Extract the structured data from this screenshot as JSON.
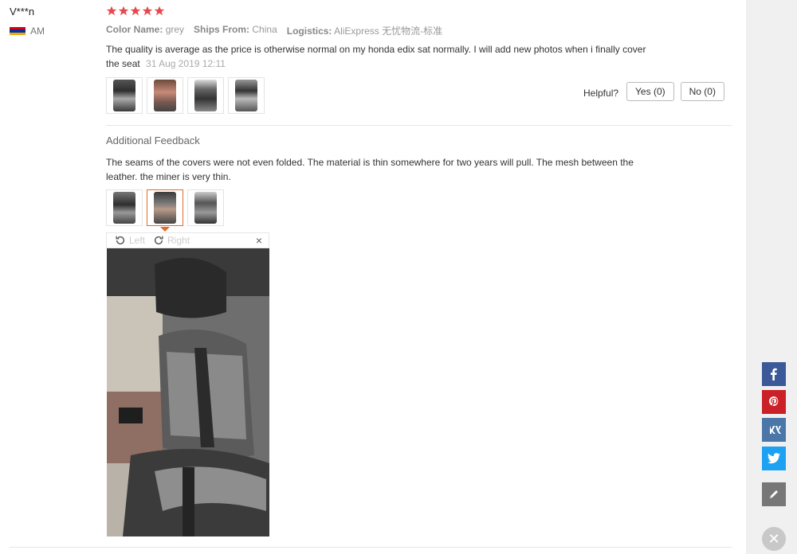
{
  "reviewer": {
    "name": "V***n",
    "country_code": "AM",
    "flag_colors": [
      "#d90012",
      "#0033a0",
      "#f2a800"
    ]
  },
  "rating": {
    "stars": 5,
    "star_color": "#e5484d"
  },
  "meta": {
    "color_label": "Color Name:",
    "color_value": "grey",
    "ships_label": "Ships From:",
    "ships_value": "China",
    "logistics_label": "Logistics:",
    "logistics_value": "AliExpress 无忧物流-标准"
  },
  "review": {
    "text": "The quality is average as the price is otherwise normal on my honda edix sat normally. I will add new photos when i finally cover the seat",
    "date": "31 Aug 2019 12:11",
    "photos": [
      "seat-photo-1",
      "seat-photo-2",
      "seat-photo-3",
      "seat-photo-4"
    ]
  },
  "helpful": {
    "label": "Helpful?",
    "yes_label": "Yes (0)",
    "no_label": "No (0)"
  },
  "additional": {
    "title": "Additional Feedback",
    "text": "The seams of the covers were not even folded. The material is thin somewhere for two years will pull. The mesh between the leather. the miner is very thin.",
    "photos": [
      "feedback-photo-1",
      "feedback-photo-2",
      "feedback-photo-3"
    ],
    "selected_photo_index": 1
  },
  "viewer": {
    "rotate_left_label": "Left",
    "rotate_right_label": "Right",
    "close_symbol": "×"
  },
  "share": {
    "facebook_color": "#3b5998",
    "pinterest_color": "#cb2027",
    "vk_color": "#4a76a8",
    "twitter_color": "#1da1f2",
    "edit_color": "#777777"
  },
  "colors": {
    "accent": "#e26a2c",
    "star": "#e5484d"
  }
}
